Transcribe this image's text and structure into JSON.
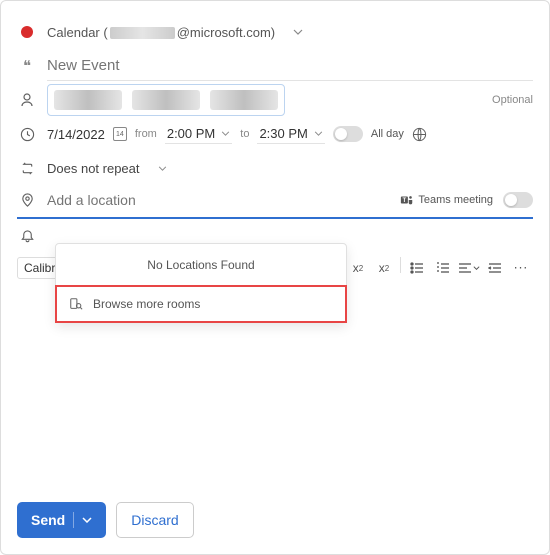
{
  "calendar": {
    "prefix": "Calendar (",
    "suffix": "@microsoft.com)"
  },
  "event": {
    "title_placeholder": "New Event"
  },
  "optional_label": "Optional",
  "datetime": {
    "date": "7/14/2022",
    "day_num": "14",
    "from_label": "from",
    "start_time": "2:00 PM",
    "to_label": "to",
    "end_time": "2:30 PM",
    "all_day_label": "All day"
  },
  "repeat": {
    "text": "Does not repeat"
  },
  "location": {
    "placeholder": "Add a location",
    "teams_label": "Teams meeting",
    "dropdown": {
      "no_results": "No Locations Found",
      "browse": "Browse more rooms"
    }
  },
  "toolbar": {
    "font": "Calibri"
  },
  "footer": {
    "send": "Send",
    "discard": "Discard"
  }
}
